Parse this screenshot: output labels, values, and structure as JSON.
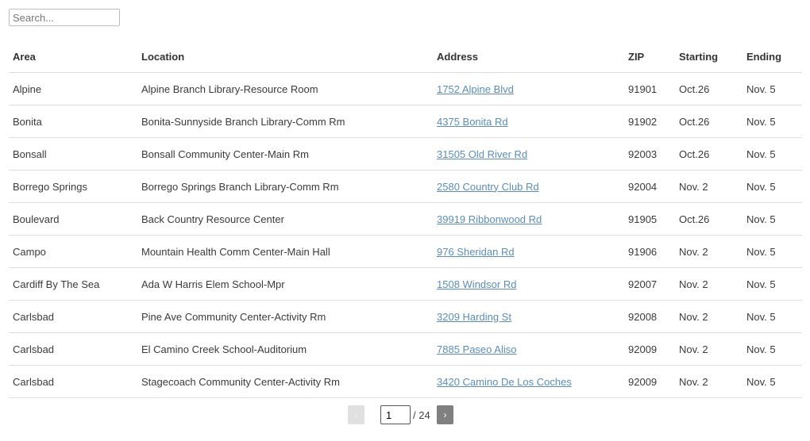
{
  "search": {
    "placeholder": "Search...",
    "value": ""
  },
  "table": {
    "headers": [
      "Area",
      "Location",
      "Address",
      "ZIP",
      "Starting",
      "Ending"
    ],
    "rows": [
      {
        "area": "Alpine",
        "location": "Alpine Branch Library-Resource Room",
        "address": "1752 Alpine Blvd",
        "zip": "91901",
        "starting": "Oct.26",
        "ending": "Nov. 5"
      },
      {
        "area": "Bonita",
        "location": "Bonita-Sunnyside Branch Library-Comm Rm",
        "address": "4375 Bonita Rd",
        "zip": "91902",
        "starting": "Oct.26",
        "ending": "Nov. 5"
      },
      {
        "area": "Bonsall",
        "location": "Bonsall Community Center-Main Rm",
        "address": "31505 Old River Rd",
        "zip": "92003",
        "starting": "Oct.26",
        "ending": "Nov. 5"
      },
      {
        "area": "Borrego Springs",
        "location": "Borrego Springs Branch Library-Comm Rm",
        "address": "2580 Country Club Rd",
        "zip": "92004",
        "starting": "Nov. 2",
        "ending": "Nov. 5"
      },
      {
        "area": "Boulevard",
        "location": "Back Country Resource Center",
        "address": "39919 Ribbonwood Rd",
        "zip": "91905",
        "starting": "Oct.26",
        "ending": "Nov. 5"
      },
      {
        "area": "Campo",
        "location": "Mountain Health Comm Center-Main Hall",
        "address": "976 Sheridan Rd",
        "zip": "91906",
        "starting": "Nov. 2",
        "ending": "Nov. 5"
      },
      {
        "area": "Cardiff By The Sea",
        "location": "Ada W Harris Elem School-Mpr",
        "address": "1508 Windsor Rd",
        "zip": "92007",
        "starting": "Nov. 2",
        "ending": "Nov. 5"
      },
      {
        "area": "Carlsbad",
        "location": "Pine Ave Community Center-Activity Rm",
        "address": "3209 Harding St",
        "zip": "92008",
        "starting": "Nov. 2",
        "ending": "Nov. 5"
      },
      {
        "area": "Carlsbad",
        "location": "El Camino Creek School-Auditorium",
        "address": "7885 Paseo Aliso",
        "zip": "92009",
        "starting": "Nov. 2",
        "ending": "Nov. 5"
      },
      {
        "area": "Carlsbad",
        "location": "Stagecoach Community Center-Activity Rm",
        "address": "3420 Camino De Los Coches",
        "zip": "92009",
        "starting": "Nov. 2",
        "ending": "Nov. 5"
      }
    ]
  },
  "pagination": {
    "prev_icon": "‹",
    "next_icon": "›",
    "current_page": "1",
    "total_label": "/ 24"
  },
  "colors": {
    "link": "#5b8db8",
    "next_button": "#808080",
    "prev_button_disabled": "#e0e0e0"
  }
}
